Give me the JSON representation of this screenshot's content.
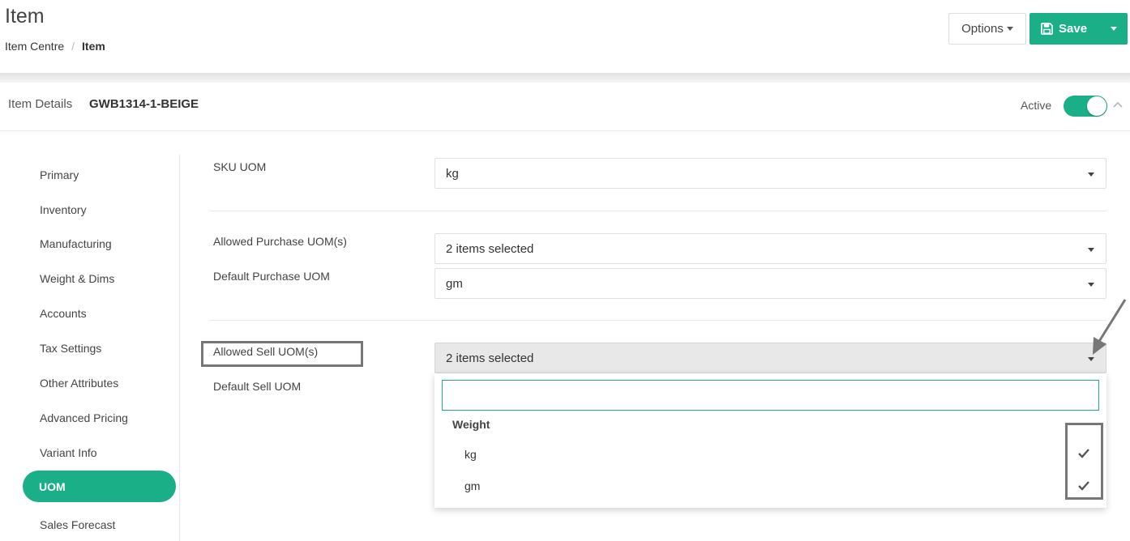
{
  "header": {
    "title": "Item",
    "breadcrumb": {
      "parent": "Item Centre",
      "separator": "/",
      "current": "Item"
    },
    "options_label": "Options",
    "save_label": "Save"
  },
  "details": {
    "label": "Item Details",
    "code": "GWB1314-1-BEIGE",
    "active_label": "Active",
    "active": true
  },
  "sidebar": {
    "items": [
      {
        "label": "Primary"
      },
      {
        "label": "Inventory"
      },
      {
        "label": "Manufacturing"
      },
      {
        "label": "Weight & Dims"
      },
      {
        "label": "Accounts"
      },
      {
        "label": "Tax Settings"
      },
      {
        "label": "Other Attributes"
      },
      {
        "label": "Advanced Pricing"
      },
      {
        "label": "Variant Info"
      },
      {
        "label": "UOM"
      },
      {
        "label": "Sales Forecast"
      }
    ],
    "active": "UOM"
  },
  "form": {
    "sku_uom": {
      "label": "SKU UOM",
      "value": "kg"
    },
    "allowed_purchase": {
      "label": "Allowed Purchase UOM(s)",
      "value": "2 items selected"
    },
    "default_purchase": {
      "label": "Default Purchase UOM",
      "value": "gm"
    },
    "allowed_sell": {
      "label": "Allowed Sell UOM(s)",
      "value": "2 items selected"
    },
    "default_sell": {
      "label": "Default Sell UOM"
    }
  },
  "dropdown": {
    "search_value": "",
    "group_label": "Weight",
    "options": [
      {
        "label": "kg",
        "selected": true
      },
      {
        "label": "gm",
        "selected": true
      }
    ]
  },
  "colors": {
    "accent": "#1aaf87",
    "annotation": "#777777"
  }
}
